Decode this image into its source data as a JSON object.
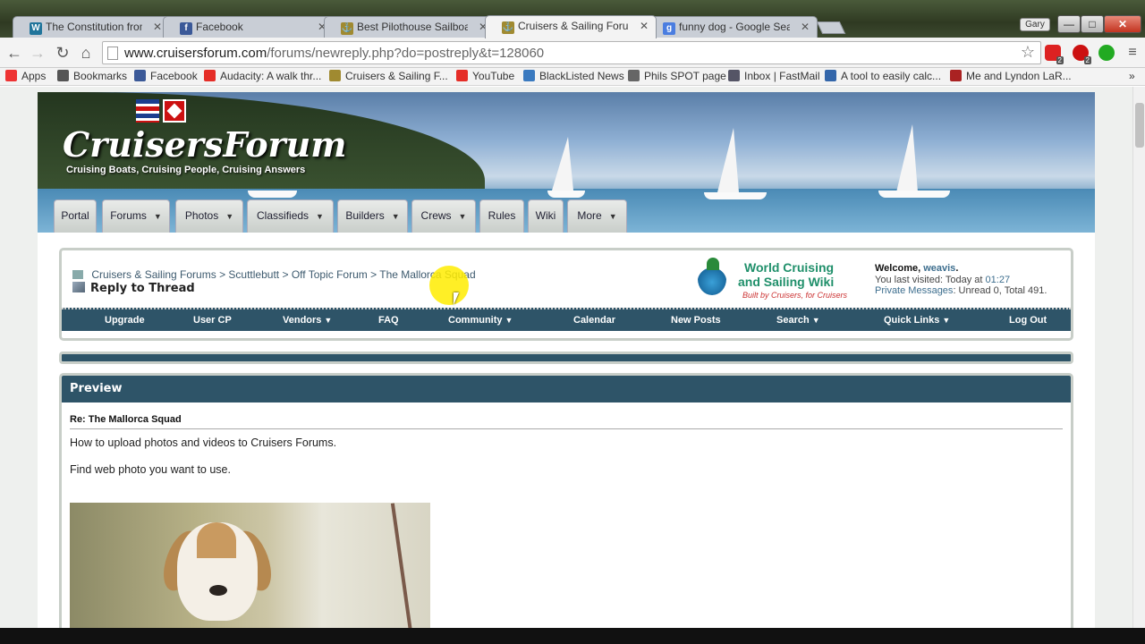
{
  "browser": {
    "tabs": [
      {
        "title": "The Constitution from the",
        "favicon": "wordpress-icon",
        "color": "#21759b",
        "glyph": "W"
      },
      {
        "title": "Facebook",
        "favicon": "facebook-icon",
        "color": "#3b5998",
        "glyph": "f"
      },
      {
        "title": "Best Pilothouse Sailboat?",
        "favicon": "cruisers-forum-icon",
        "color": "#a08a30",
        "glyph": "⚓"
      },
      {
        "title": "Cruisers & Sailing Forums",
        "favicon": "cruisers-forum-icon",
        "color": "#a08a30",
        "glyph": "⚓"
      },
      {
        "title": "funny dog - Google Searc",
        "favicon": "google-icon",
        "color": "#4a7de0",
        "glyph": "g"
      }
    ],
    "user_badge": "Gary",
    "window_controls": {
      "minimize": "—",
      "maximize": "□",
      "close": "✕"
    },
    "url_host": "www.cruisersforum.com",
    "url_path": "/forums/newreply.php?do=postreply&t=128060",
    "extension_badges": [
      "2",
      "2"
    ],
    "bookmarks": [
      {
        "label": "Apps",
        "icon": "apps-grid-icon",
        "color": "#e33"
      },
      {
        "label": "Bookmarks",
        "icon": "star-icon",
        "color": "#555"
      },
      {
        "label": "Facebook",
        "icon": "facebook-icon",
        "color": "#3b5998"
      },
      {
        "label": "Audacity: A walk thr...",
        "icon": "youtube-icon",
        "color": "#e52d27"
      },
      {
        "label": "Cruisers & Sailing F...",
        "icon": "cruisers-forum-icon",
        "color": "#a08a30"
      },
      {
        "label": "YouTube",
        "icon": "youtube-icon",
        "color": "#e52d27"
      },
      {
        "label": "BlackListed News",
        "icon": "globe-icon",
        "color": "#3a7ac0"
      },
      {
        "label": "Phils SPOT page",
        "icon": "spot-icon",
        "color": "#666"
      },
      {
        "label": "Inbox | FastMail",
        "icon": "mail-icon",
        "color": "#556"
      },
      {
        "label": "A tool to easily calc...",
        "icon": "calc-icon",
        "color": "#3366aa"
      },
      {
        "label": "Me and Lyndon LaR...",
        "icon": "ew-icon",
        "color": "#a22"
      }
    ],
    "bookmarks_overflow": "»"
  },
  "site": {
    "logo": "CruisersForum",
    "tagline": "Cruising Boats, Cruising People, Cruising Answers",
    "nav_tabs": [
      {
        "label": "Portal",
        "dropdown": false
      },
      {
        "label": "Forums",
        "dropdown": true
      },
      {
        "label": "Photos",
        "dropdown": true
      },
      {
        "label": "Classifieds",
        "dropdown": true
      },
      {
        "label": "Builders",
        "dropdown": true
      },
      {
        "label": "Crews",
        "dropdown": true
      },
      {
        "label": "Rules",
        "dropdown": false
      },
      {
        "label": "Wiki",
        "dropdown": false
      },
      {
        "label": "More",
        "dropdown": true
      }
    ],
    "breadcrumb": [
      "Cruisers & Sailing Forums",
      "Scuttlebutt",
      "Off Topic Forum",
      "The Mallorca Squad"
    ],
    "breadcrumb_sep": ">",
    "page_title": "Reply to Thread",
    "wiki": {
      "line1": "World Cruising",
      "line2": "and Sailing Wiki",
      "line3": "Built by Cruisers, for Cruisers"
    },
    "welcome": {
      "label": "Welcome,",
      "username": "weavis",
      "last_visited_label": "You last visited: Today at",
      "last_visited_time": "01:27",
      "pm_label": "Private Messages",
      "pm_counts": ": Unread 0, Total 491."
    },
    "navbar": [
      {
        "label": "Upgrade",
        "dropdown": false
      },
      {
        "label": "User CP",
        "dropdown": false
      },
      {
        "label": "Vendors",
        "dropdown": true
      },
      {
        "label": "FAQ",
        "dropdown": false
      },
      {
        "label": "Community",
        "dropdown": true
      },
      {
        "label": "Calendar",
        "dropdown": false
      },
      {
        "label": "New Posts",
        "dropdown": false
      },
      {
        "label": "Search",
        "dropdown": true
      },
      {
        "label": "Quick Links",
        "dropdown": true
      },
      {
        "label": "Log Out",
        "dropdown": false
      }
    ],
    "preview": {
      "header": "Preview",
      "title": "Re: The Mallorca Squad",
      "lines": [
        "How to upload photos and videos to Cruisers Forums.",
        "Find web photo you want to use."
      ]
    }
  }
}
